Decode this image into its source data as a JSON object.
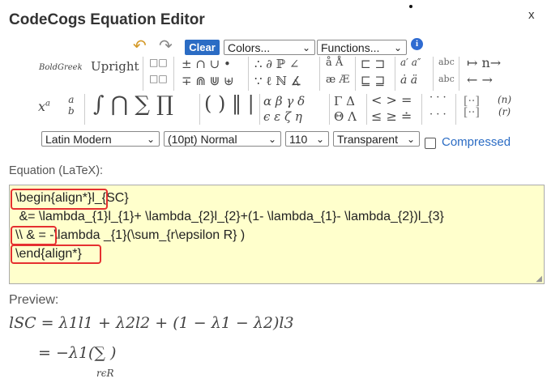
{
  "window": {
    "title": "CodeCogs Equation Editor",
    "close_label": "x"
  },
  "toolbar": {
    "undo_icon": "undo-icon",
    "redo_icon": "redo-icon",
    "clear_label": "Clear",
    "colors_value": "Colors...",
    "functions_value": "Functions...",
    "info_label": "i"
  },
  "palette": {
    "bold_greek": "BoldGreek",
    "upright": "Upright",
    "row_a": [
      "± ∩ ∪ •",
      "∴ ∂ ℙ ∠",
      "å Å",
      "⊏ ⊐",
      "a′ a″"
    ],
    "row_b": [
      "∓ ⋒ ⋓ ⊎",
      "∵ ℓ ℕ ∡",
      "æ Æ",
      "⊑ ⊒",
      "ȧ ä"
    ],
    "arrows_a": "↦ n→",
    "arrows_b": "← →",
    "big_ops": "∫ ⋂ ∑ ∏",
    "delims": "( ) ‖ |",
    "greek_a": "α β γ δ",
    "greek_b": "ϵ ε ζ η",
    "ugreek_a": "Γ Δ",
    "ugreek_b": "Θ Λ",
    "rel_a": "< > =",
    "rel_b": "≤ ≥ ≐",
    "dots_a": "· · ·",
    "dots_b": "· · ·"
  },
  "options": {
    "font_value": "Latin Modern",
    "size_value": "(10pt) Normal",
    "dpi_value": "110",
    "bg_value": "Transparent",
    "compressed_label": "Compressed",
    "compressed_checked": false
  },
  "equation": {
    "label": "Equation (LaTeX):",
    "lines": [
      "\\begin{align*}l_{SC}",
      " &= \\lambda_{1}l_{1}+ \\lambda_{2}l_{2}+(1- \\lambda_{1}- \\lambda_{2})l_{3}",
      "\\\\ & = -\\lambda _{1}(\\sum_{r\\epsilon R} )",
      "\\end{align*}"
    ]
  },
  "preview": {
    "label": "Preview:",
    "line1": "lSC = λ1l1 + λ2l2 + (1 − λ1 − λ2)l3",
    "line2": "= −λ1(∑ )",
    "sum_subscript": "rϵR"
  }
}
